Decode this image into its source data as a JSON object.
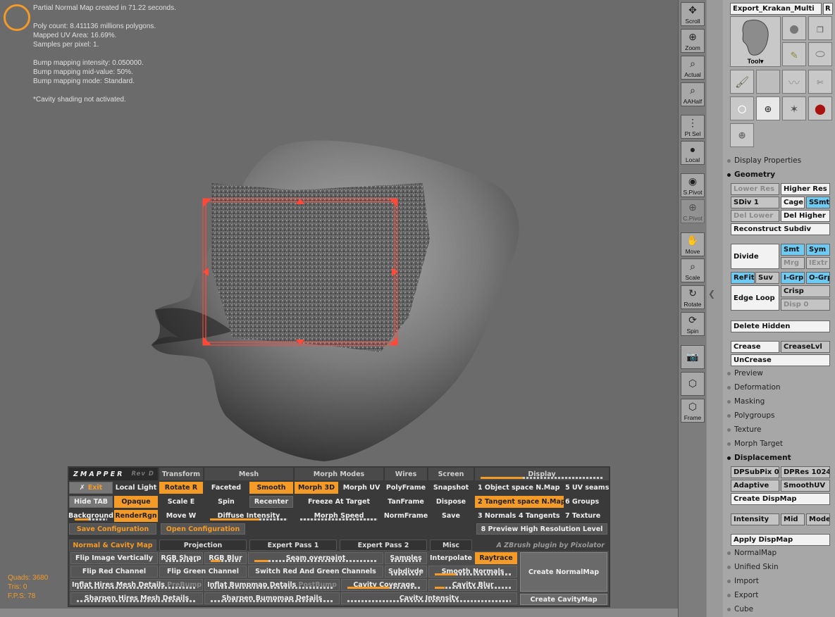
{
  "info": {
    "lines": [
      "Partial Normal Map created in 71.22 seconds.",
      "",
      "Poly count: 8.411136 millions polygons.",
      "Mapped UV Area: 16.69%.",
      "Samples per pixel: 1.",
      "",
      "Bump mapping intensity: 0.050000.",
      "Bump mapping mid-value: 50%.",
      "Bump mapping mode: Standard.",
      "",
      "*Cavity shading not activated."
    ]
  },
  "stats": {
    "quads": "Quads: 3680",
    "tris": "Tris: 0",
    "fps": "F.P.S: 78"
  },
  "zmapper": {
    "logo": "ZMAPPER",
    "rev": "Rev D",
    "headers": {
      "transform": "Transform",
      "mesh": "Mesh",
      "morph": "Morph Modes",
      "wires": "Wires",
      "screen": "Screen",
      "display": "Display"
    },
    "exit": "Exit",
    "local_light": "Local Light",
    "rotate": "Rotate R",
    "faceted": "Faceted",
    "smooth": "Smooth",
    "morph3d": "Morph 3D",
    "morphuv": "Morph UV",
    "polyframe": "PolyFrame",
    "snapshot": "Snapshot",
    "hide_tab": "Hide TAB",
    "opaque": "Opaque",
    "scale": "Scale E",
    "spin": "Spin",
    "recenter": "Recenter",
    "freeze": "Freeze At Target",
    "tanframe": "TanFrame",
    "dispose": "Dispose",
    "background": "Background",
    "renderrgn": "RenderRgn",
    "move": "Move W",
    "diffuse": "Diffuse Intensity",
    "morph_speed": "Morph Speed",
    "normframe": "NormFrame",
    "save": "Save",
    "display_items": [
      "1 Object space N.Map",
      "5 UV seams",
      "2 Tangent space N.Map",
      "6 Groups",
      "3 Normals",
      "4 Tangents",
      "7 Texture",
      "8 Preview High Resolution Level"
    ],
    "save_config": "Save Configuration",
    "open_config": "Open Configuration",
    "credit": "A ZBrush plugin by Pixolator",
    "tabs": [
      "Normal & Cavity Map",
      "Projection",
      "Expert Pass 1",
      "Expert Pass 2",
      "Misc"
    ],
    "flip_vert": "Flip Image Vertically",
    "rgb_sharp": "RGB Sharp",
    "rgb_blur": "RGB Blur",
    "seam_overpaint": "Seam overpaint",
    "samples": "Samples",
    "interpolate": "Interpolate",
    "raytrace": "Raytrace",
    "flip_red": "Flip Red Channel",
    "flip_green": "Flip Green Channel",
    "switch_rg": "Switch Red And Green Channels",
    "subdivide": "Subdivde",
    "smooth_normals": "Smooth Normals",
    "create_normalmap": "Create NormalMap",
    "inflate_hires": "Inflat Hires Mesh Details",
    "prebump": "PreBump",
    "inflate_bump": "Inflat Bumpmap Details",
    "postbump": "PostBump",
    "cavity_coverage": "Cavity Coverage",
    "cavity_blur": "Cavity Blur",
    "sharpen_hires": "Sharpen Hires Mesh Details",
    "sharpen_bump": "Sharpen Bumpmap Details",
    "cavity_intensity": "Cavity Intensity",
    "create_cavitymap": "Create CavityMap"
  },
  "toolbar": [
    "Scroll",
    "Zoom",
    "Actual",
    "AAHalf",
    "Pt Sel",
    "Local",
    "S.Pivot",
    "C.Pivot",
    "Move",
    "Scale",
    "Rotate",
    "Spin",
    "",
    "",
    "Frame"
  ],
  "panel": {
    "tool_name": "Export_Krakan_Multi",
    "r": "R",
    "tool_label": "Tool",
    "display_properties": "Display Properties",
    "geometry": "Geometry",
    "lower_res": "Lower Res",
    "higher_res": "Higher Res",
    "sdiv": "SDiv 1",
    "cage": "Cage",
    "ssmt": "SSmt",
    "del_lower": "Del Lower",
    "del_higher": "Del Higher",
    "reconstruct": "Reconstruct Subdiv",
    "divide": "Divide",
    "smt": "Smt",
    "sym": "Sym",
    "mrg": "Mrg",
    "iextr": "IExtr",
    "refit": "ReFit",
    "suv": "Suv",
    "igrp": "I-Grp",
    "ogrp": "O-Grp",
    "edge_loop": "Edge Loop",
    "crisp": "Crisp",
    "disp": "Disp 0",
    "delete_hidden": "Delete Hidden",
    "crease": "Crease",
    "creaselvl": "CreaseLvl",
    "uncrease": "UnCrease",
    "preview": "Preview",
    "deformation": "Deformation",
    "masking": "Masking",
    "polygroups": "Polygroups",
    "texture": "Texture",
    "morph_target": "Morph Target",
    "displacement": "Displacement",
    "dpsubpix": "DPSubPix 0",
    "dpres": "DPRes 1024",
    "adaptive": "Adaptive",
    "smoothuv": "SmoothUV",
    "create_dispmap": "Create DispMap",
    "intensity": "Intensity",
    "mid": "Mid",
    "mode": "Mode",
    "apply_dispmap": "Apply DispMap",
    "normalmap": "NormalMap",
    "unified_skin": "Unified Skin",
    "import": "Import",
    "export": "Export",
    "cube": "Cube"
  }
}
